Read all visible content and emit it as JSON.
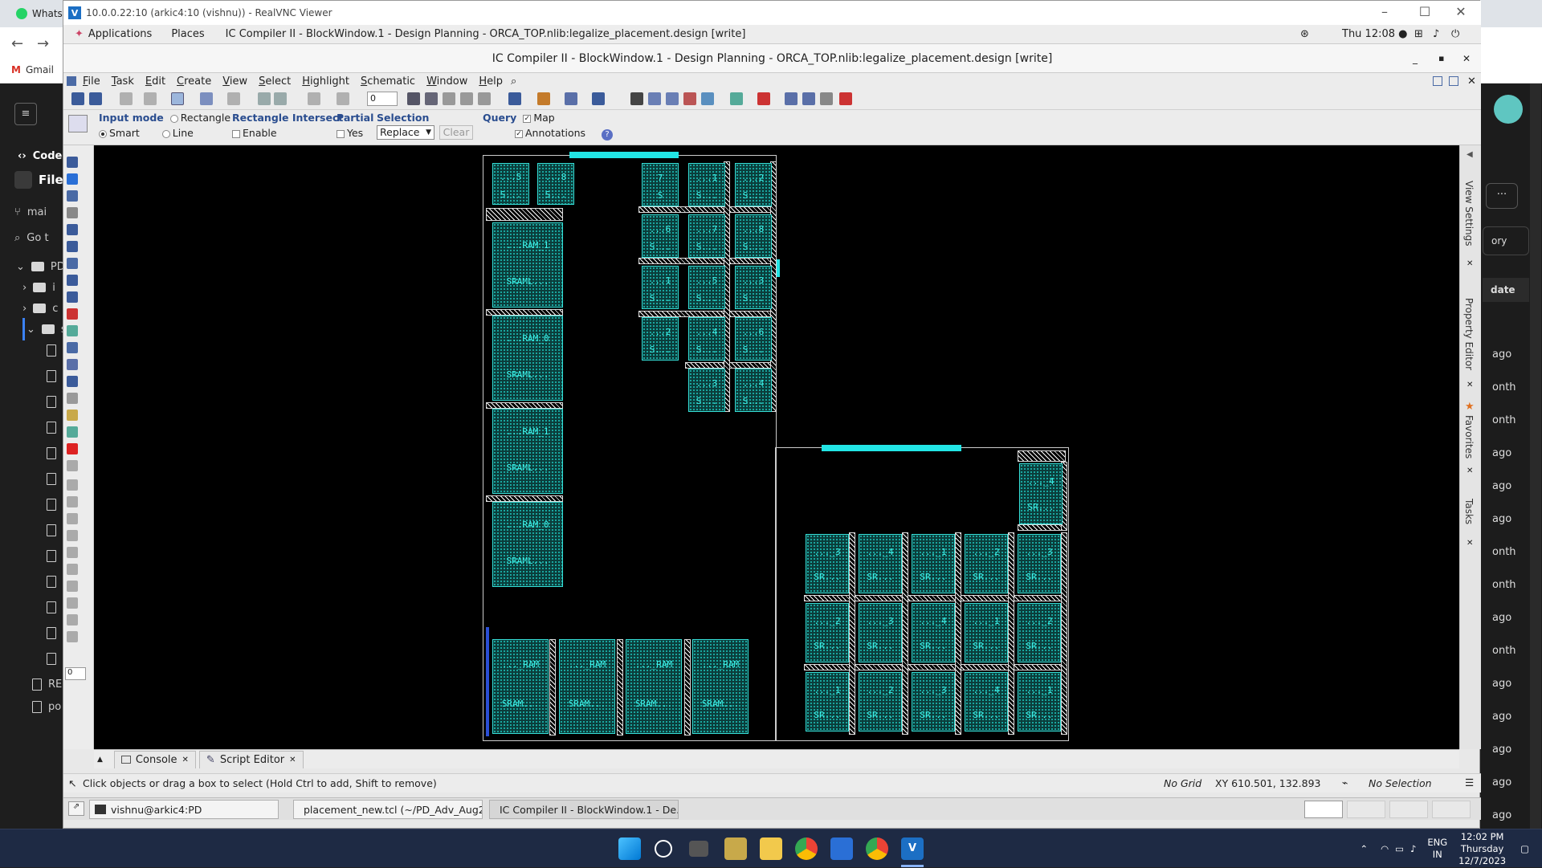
{
  "background_browser": {
    "whatsapp_tab": "Whats",
    "gmail_bookmark": "Gmail",
    "code_label": "Code",
    "file_label": "File",
    "branch": "mai",
    "goto_placeholder": "Go t",
    "folders": [
      "PD",
      "i",
      "c",
      "s"
    ],
    "files_bottom": [
      "RE",
      "po"
    ],
    "right_items": [
      "ory",
      "date",
      "ago",
      "onth",
      "onth",
      "ago",
      "ago",
      "ago",
      "onth",
      "onth",
      "ago",
      "onth",
      "ago",
      "ago",
      "ago",
      "ago",
      "ago"
    ]
  },
  "vnc": {
    "title": "10.0.0.22:10 (arkic4:10 (vishnu)) - RealVNC Viewer"
  },
  "gnome": {
    "applications": "Applications",
    "places": "Places",
    "window_title": "IC Compiler II - BlockWindow.1 - Design Planning - ORCA_TOP.nlib:legalize_placement.design [write]",
    "clock": "Thu 12:08 ●"
  },
  "app": {
    "title": "IC Compiler II - BlockWindow.1 - Design Planning - ORCA_TOP.nlib:legalize_placement.design [write]",
    "menu": [
      "File",
      "Task",
      "Edit",
      "Create",
      "View",
      "Select",
      "Highlight",
      "Schematic",
      "Window",
      "Help"
    ],
    "toolbar_value": "0",
    "options": {
      "input_mode_label": "Input mode",
      "rectangle": "Rectangle",
      "smart": "Smart",
      "line": "Line",
      "rect_intersect_label": "Rectangle Intersect",
      "enable": "Enable",
      "partial_label": "Partial",
      "yes": "Yes",
      "selection_label": "Selection",
      "selection_value": "Replace",
      "clear": "Clear",
      "query_label": "Query",
      "map": "Map",
      "annotations": "Annotations"
    },
    "side_tabs": [
      "View Settings",
      "Property Editor",
      "Favorites",
      "Tasks"
    ],
    "left_input_value": "0",
    "console_tabs": [
      "Console",
      "Script Editor"
    ],
    "status": {
      "hint": "Click objects or drag a box to select (Hold Ctrl to add, Shift to remove)",
      "grid": "No Grid",
      "xy": "XY 610.501, 132.893",
      "selection": "No Selection"
    },
    "tasks": [
      "vishnu@arkic4:PD",
      "placement_new.tcl (~/PD_Adv_Aug2...",
      "IC Compiler II - BlockWindow.1 - De..."
    ]
  },
  "layout_cells": {
    "top_left_small": [
      {
        "l1": "...5",
        "l2": "S..."
      },
      {
        "l1": "...8",
        "l2": "S..."
      }
    ],
    "left_column": [
      {
        "l1": "...RAM_1",
        "l2": "SRAML..."
      },
      {
        "l1": "...RAM_0",
        "l2": "SRAML..."
      },
      {
        "l1": "...RAM_1",
        "l2": "SRAML..."
      },
      {
        "l1": "...RAM_0",
        "l2": "SRAML..."
      }
    ],
    "top_grid": [
      {
        "l1": "7",
        "l2": "S"
      },
      {
        "l1": "...1",
        "l2": "S..."
      },
      {
        "l1": "...2",
        "l2": "S..."
      },
      {
        "l1": "...6",
        "l2": "S..."
      },
      {
        "l1": "...7",
        "l2": "S..."
      },
      {
        "l1": "...8",
        "l2": "S..."
      },
      {
        "l1": "...1",
        "l2": "S..."
      },
      {
        "l1": "...5",
        "l2": "S..."
      },
      {
        "l1": "...3",
        "l2": "S..."
      },
      {
        "l1": "...2",
        "l2": "S..."
      },
      {
        "l1": "...4",
        "l2": "S..."
      },
      {
        "l1": "...6",
        "l2": "S..."
      }
    ],
    "top_grid_tail": [
      {
        "l1": "...3",
        "l2": "S..."
      },
      {
        "l1": "...4",
        "l2": "S..."
      }
    ],
    "bottom_left": [
      {
        "l1": "..._RAM",
        "l2": "SRAM..."
      },
      {
        "l1": "..._RAM",
        "l2": "SRAM..."
      },
      {
        "l1": "..._RAM",
        "l2": "SRAM..."
      },
      {
        "l1": "..._RAM",
        "l2": "SRAM..."
      }
    ],
    "right_single": {
      "l1": "..._4",
      "l2": "SR..."
    },
    "right_grid": [
      {
        "l1": "..._3",
        "l2": "SR..."
      },
      {
        "l1": "..._4",
        "l2": "SR..."
      },
      {
        "l1": "..._1",
        "l2": "SR..."
      },
      {
        "l1": "..._2",
        "l2": "SR..."
      },
      {
        "l1": "..._3",
        "l2": "SR..."
      },
      {
        "l1": "..._2",
        "l2": "SR..."
      },
      {
        "l1": "..._3",
        "l2": "SR..."
      },
      {
        "l1": "..._4",
        "l2": "SR..."
      },
      {
        "l1": "..._1",
        "l2": "SR..."
      },
      {
        "l1": "..._2",
        "l2": "SR..."
      },
      {
        "l1": "..._1",
        "l2": "SR..."
      },
      {
        "l1": "..._2",
        "l2": "SR..."
      },
      {
        "l1": "..._3",
        "l2": "SR..."
      },
      {
        "l1": "..._4",
        "l2": "SR..."
      },
      {
        "l1": "..._1",
        "l2": "SR..."
      }
    ]
  },
  "windows_taskbar": {
    "lang1": "ENG",
    "lang2": "IN",
    "time": "12:02 PM",
    "day": "Thursday",
    "date": "12/7/2023"
  },
  "colors": {
    "macro_fill": "#0b3d3b",
    "macro_text": "#3ff3ea",
    "canvas": "#000000",
    "taskbar": "#1e2a44"
  }
}
